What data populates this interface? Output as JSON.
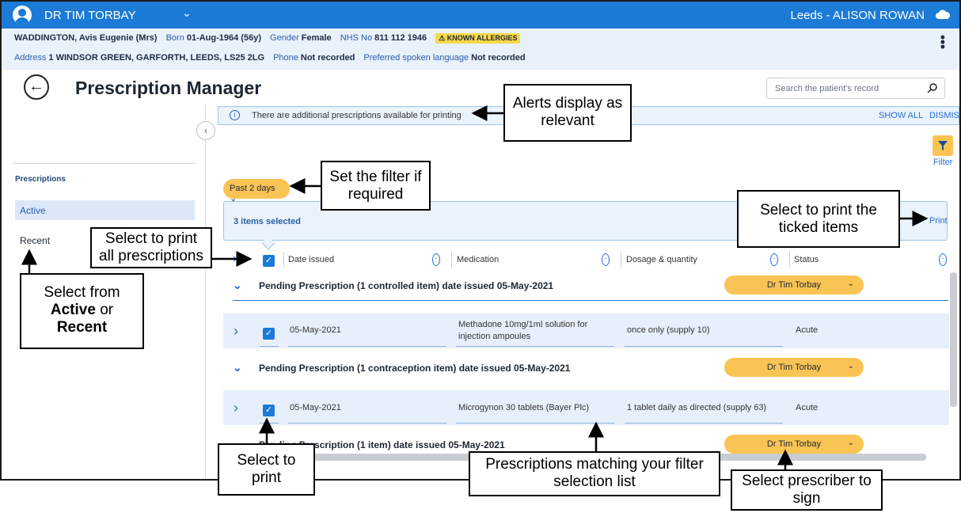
{
  "topbar": {
    "user": "DR TIM TORBAY",
    "location": "Leeds - ALISON ROWAN"
  },
  "patient": {
    "name": "WADDINGTON, Avis Eugenie (Mrs)",
    "born_label": "Born",
    "born": "01-Aug-1964 (56y)",
    "gender_label": "Gender",
    "gender": "Female",
    "nhs_label": "NHS No",
    "nhs": "811 112 1946",
    "allergy": "KNOWN ALLERGIES",
    "address_label": "Address",
    "address": "1 WINDSOR GREEN, GARFORTH, LEEDS, LS25 2LG",
    "phone_label": "Phone",
    "phone": "Not recorded",
    "language_label": "Preferred spoken language",
    "language": "Not recorded"
  },
  "page": {
    "title": "Prescription Manager",
    "search_placeholder": "Search the patient's record"
  },
  "sidebar": {
    "heading": "Prescriptions",
    "items": [
      "Active",
      "Recent"
    ]
  },
  "alert": {
    "message": "There are additional prescriptions available for printing",
    "show_all": "SHOW ALL",
    "dismiss": "DISMISS"
  },
  "filter": {
    "label": "Filter",
    "chip": "Past 2 days"
  },
  "selection": {
    "count": "3 items selected",
    "print": "Print"
  },
  "columns": [
    "Date issued",
    "Medication",
    "Dosage & quantity",
    "Status"
  ],
  "groups": [
    {
      "header": "Pending Prescription (1 controlled item) date issued 05-May-2021",
      "prescriber": "Dr Tim Torbay",
      "item": {
        "date": "05-May-2021",
        "med_line1": "Methadone 10mg/1ml solution for",
        "med_line2": "injection ampoules",
        "dosage": "once only (supply 10)",
        "status": "Acute"
      }
    },
    {
      "header": "Pending Prescription (1 contraception item) date issued 05-May-2021",
      "prescriber": "Dr Tim Torbay",
      "item": {
        "date": "05-May-2021",
        "med_line1": "Microgynon 30 tablets (Bayer Plc)",
        "med_line2": "",
        "dosage": "1 tablet daily as directed (supply 63)",
        "status": "Acute"
      }
    },
    {
      "header": "Pending Prescription (1 item) date issued 05-May-2021",
      "prescriber": "Dr Tim Torbay"
    }
  ],
  "callouts": {
    "alerts": [
      "Alerts display as",
      "relevant"
    ],
    "filter": [
      "Set the filter if",
      "required"
    ],
    "print_ticked": [
      "Select to print the",
      "ticked items"
    ],
    "print_all": [
      "Select to print",
      "all prescriptions"
    ],
    "select_from": [
      "Select from",
      "Active",
      "or",
      "Recent"
    ],
    "select_print": [
      "Select to",
      "print"
    ],
    "matching": [
      "Prescriptions matching your filter",
      "selection list"
    ],
    "prescriber": [
      "Select prescriber to",
      "sign"
    ]
  }
}
